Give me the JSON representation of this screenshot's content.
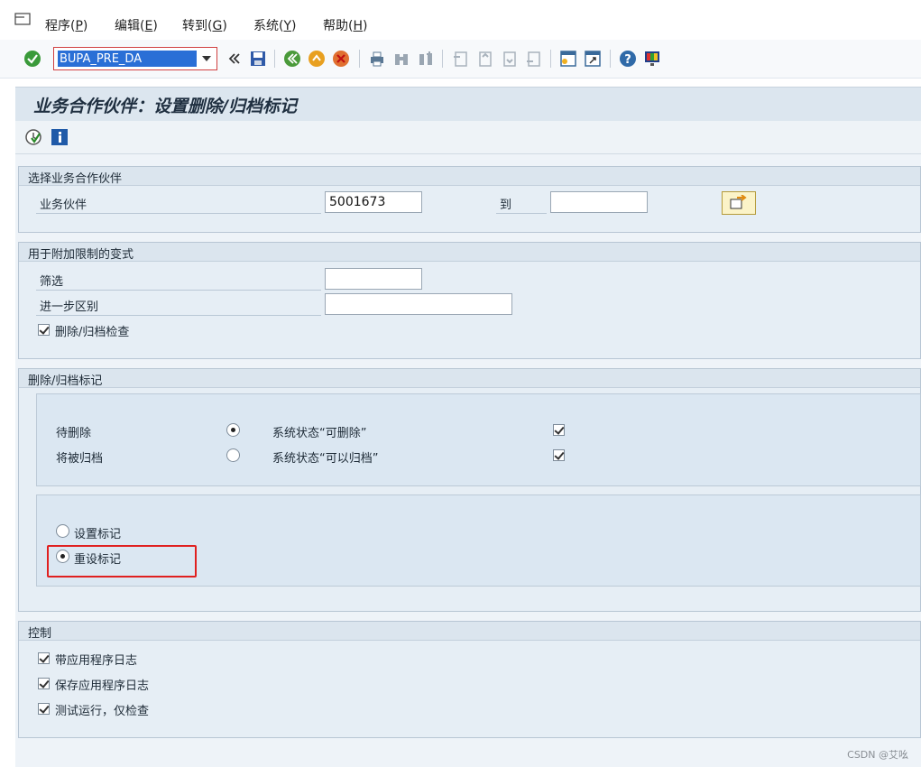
{
  "menu": {
    "items": [
      {
        "label": "程序(",
        "acc": "P",
        "end": ")"
      },
      {
        "label": "编辑(",
        "acc": "E",
        "end": ")"
      },
      {
        "label": "转到(",
        "acc": "G",
        "end": ")"
      },
      {
        "label": "系统(",
        "acc": "Y",
        "end": ")"
      },
      {
        "label": "帮助(",
        "acc": "H",
        "end": ")"
      }
    ]
  },
  "toolbar": {
    "command_value": "BUPA_PRE_DA"
  },
  "title": "业务合作伙伴：设置删除/归档标记",
  "selection_group": {
    "title": "选择业务合作伙伴",
    "bp_label": "业务伙伴",
    "bp_from": "5001673",
    "to_label": "到",
    "bp_to": ""
  },
  "variant_group": {
    "title": "用于附加限制的变式",
    "filter_label": "筛选",
    "filter_value": "",
    "further_label": "进一步区别",
    "further_value": "",
    "check_label": "删除/归档检查",
    "check_checked": true
  },
  "marker_group": {
    "title": "删除/归档标记",
    "rows": [
      {
        "label": "待删除",
        "selected": true,
        "status_label": "系统状态“可删除”",
        "status_checked": true
      },
      {
        "label": "将被归档",
        "selected": false,
        "status_label": "系统状态“可以归档”",
        "status_checked": true
      }
    ],
    "actions": [
      {
        "label": "设置标记",
        "selected": false
      },
      {
        "label": "重设标记",
        "selected": true
      }
    ]
  },
  "control_group": {
    "title": "控制",
    "items": [
      {
        "label": "带应用程序日志",
        "checked": true
      },
      {
        "label": "保存应用程序日志",
        "checked": true
      },
      {
        "label": "测试运行，仅检查",
        "checked": true
      }
    ]
  },
  "watermark": "CSDN @艾吆",
  "colors": {
    "accent": "#2a6fd6",
    "highlight": "#e02020",
    "panel": "#e6eef5"
  }
}
